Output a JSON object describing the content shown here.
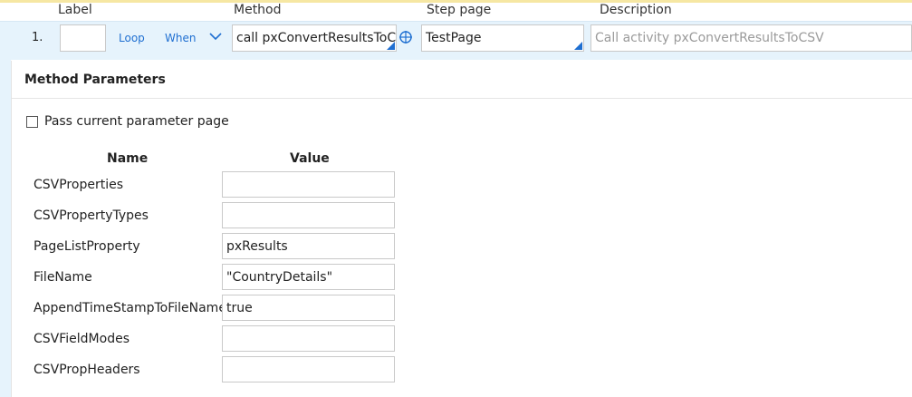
{
  "headers": {
    "label": "Label",
    "method": "Method",
    "step_page": "Step page",
    "description": "Description"
  },
  "step": {
    "number": "1.",
    "label_value": "",
    "loop_link": "Loop",
    "when_link": "When",
    "method_value": "call pxConvertResultsToCSV",
    "step_page_value": "TestPage",
    "description_placeholder": "Call activity pxConvertResultsToCSV"
  },
  "panel": {
    "title": "Method Parameters",
    "pass_param_label": "Pass current parameter page",
    "pass_param_checked": false,
    "col_name": "Name",
    "col_value": "Value",
    "params": [
      {
        "name": "CSVProperties",
        "value": ""
      },
      {
        "name": "CSVPropertyTypes",
        "value": ""
      },
      {
        "name": "PageListProperty",
        "value": "pxResults"
      },
      {
        "name": "FileName",
        "value": "\"CountryDetails\""
      },
      {
        "name": "AppendTimeStampToFileName",
        "value": "true"
      },
      {
        "name": "CSVFieldModes",
        "value": ""
      },
      {
        "name": "CSVPropHeaders",
        "value": ""
      }
    ]
  },
  "colors": {
    "accent": "#1f6fd1",
    "row_highlight": "#e6f3fc",
    "top_bar": "#f6e7a3"
  },
  "icons": [
    "chevron-down-icon",
    "crosshair-icon",
    "checkbox-icon"
  ]
}
